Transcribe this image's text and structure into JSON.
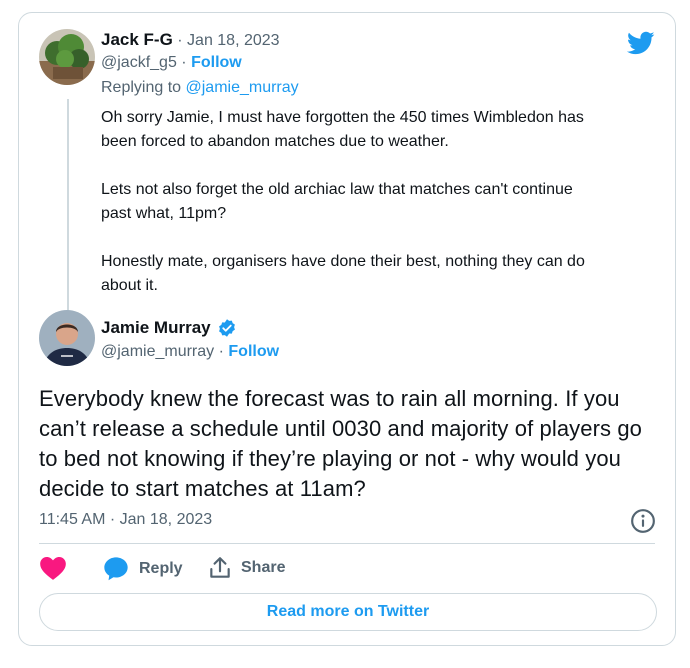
{
  "parent_tweet": {
    "author_name": "Jack F-G",
    "date": "· Jan 18, 2023",
    "handle": "@jackf_g5",
    "follow_sep": "·",
    "follow_label": "Follow",
    "replying_prefix": "Replying to",
    "replying_to": "@jamie_murray",
    "paragraphs": [
      "Oh sorry Jamie, I must have forgotten the 450 times Wimbledon has\nbeen forced to abandon  matches due to weather.",
      "Lets not also forget the old archiac law that matches can't continue\npast what, 11pm?",
      "Honestly mate, organisers have done their best, nothing they can do\nabout it."
    ]
  },
  "main_tweet": {
    "author_name": "Jamie Murray",
    "handle": "@jamie_murray",
    "follow_sep": "·",
    "follow_label": "Follow",
    "text": "Everybody knew the forecast was to rain all morning.  If you can’t release a schedule until 0030 and majority of players go to bed not knowing if they’re playing or not - why would you decide to start matches at 11am?",
    "timestamp": "11:45 AM · Jan 18, 2023"
  },
  "actions": {
    "reply_label": "Reply",
    "share_label": "Share"
  },
  "read_more_label": "Read more on Twitter",
  "colors": {
    "accent": "#1d9bf0",
    "like": "#f91880",
    "muted": "#536471",
    "border": "#cfd9de"
  },
  "icons": [
    "twitter-bird-icon",
    "verified-badge-icon",
    "info-icon",
    "heart-icon",
    "reply-bubble-icon",
    "share-icon"
  ]
}
